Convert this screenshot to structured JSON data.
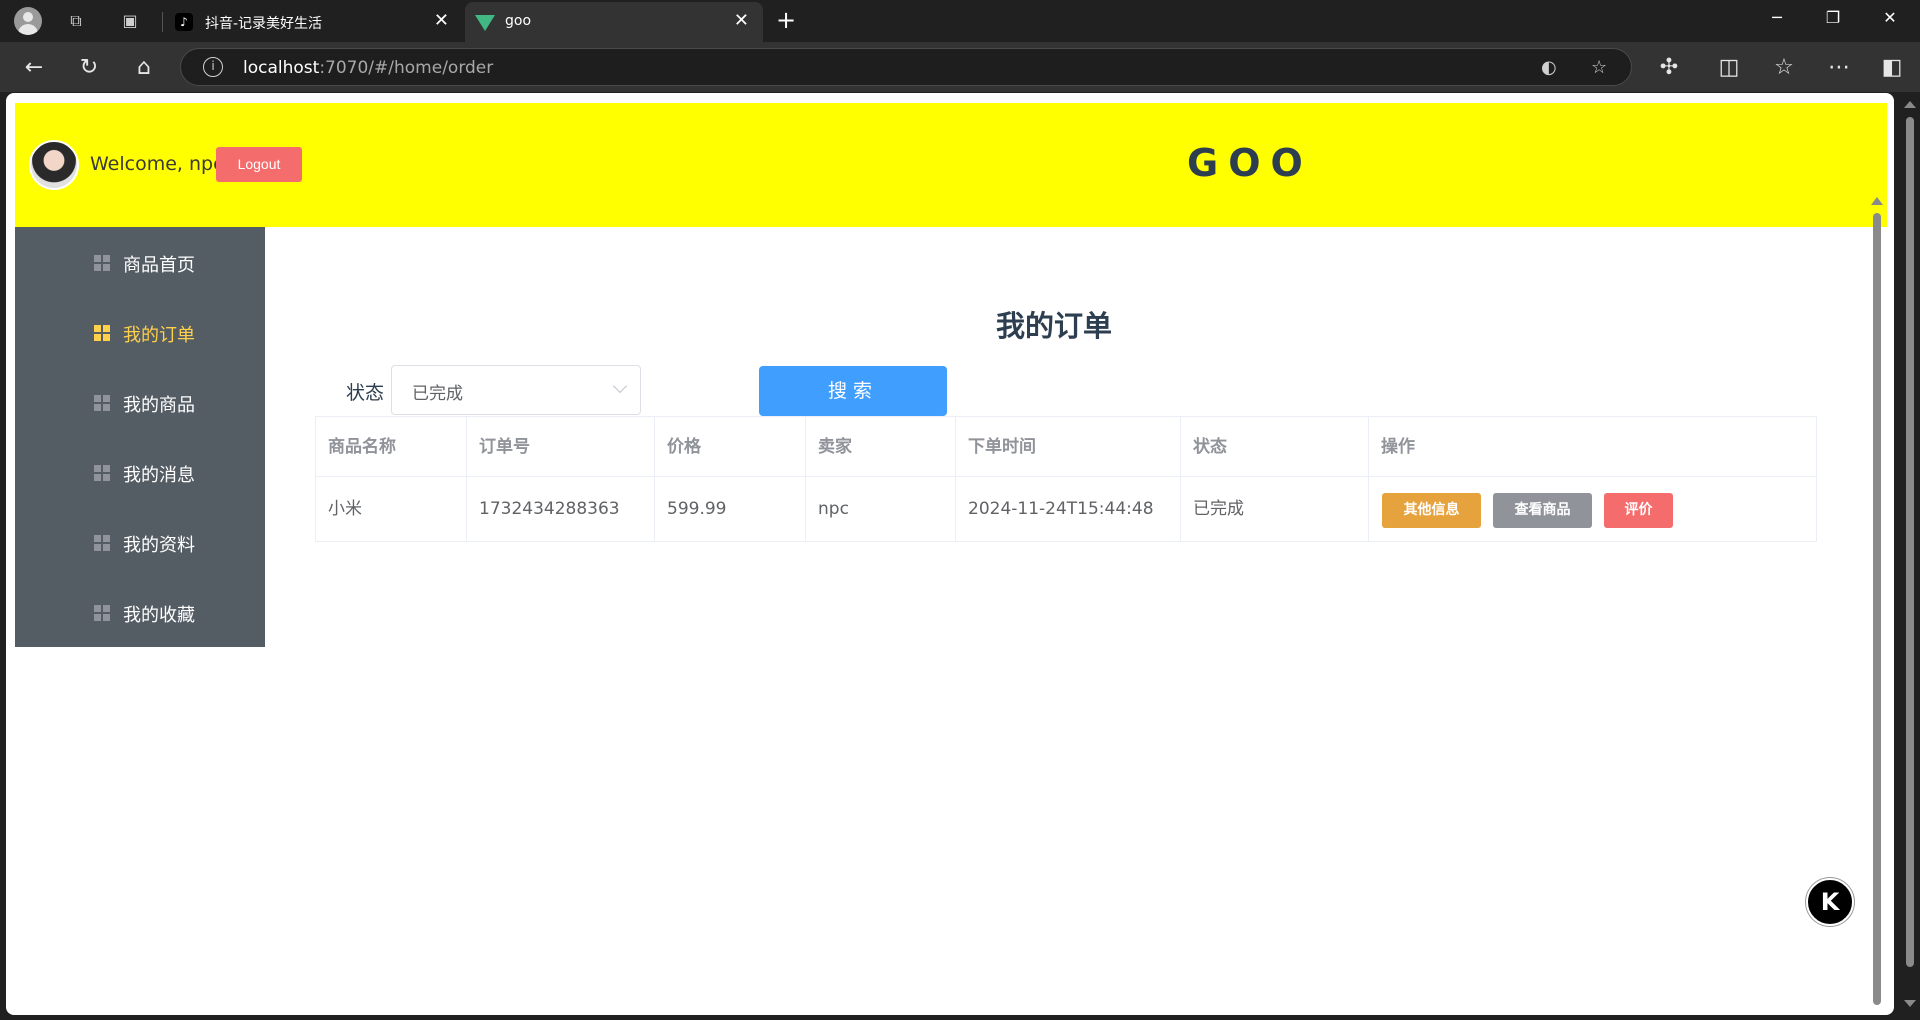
{
  "browser": {
    "tabs": [
      {
        "title": "抖音-记录美好生活",
        "favicon": "tiktok-icon",
        "active": false
      },
      {
        "title": "goo",
        "favicon": "vue-icon",
        "active": true
      }
    ],
    "url_host": "localhost",
    "url_path": ":7070/#/home/order"
  },
  "header": {
    "welcome": "Welcome, npc",
    "logout_label": "Logout",
    "brand": "GOO",
    "background": "#ffff00"
  },
  "sidebar": {
    "items": [
      {
        "label": "商品首页",
        "active": false
      },
      {
        "label": "我的订单",
        "active": true
      },
      {
        "label": "我的商品",
        "active": false
      },
      {
        "label": "我的消息",
        "active": false
      },
      {
        "label": "我的资料",
        "active": false
      },
      {
        "label": "我的收藏",
        "active": false
      }
    ],
    "active_color": "#ffd04b"
  },
  "main": {
    "title": "我的订单",
    "filter": {
      "status_label": "状态",
      "status_value": "已完成",
      "search_label": "搜索"
    },
    "table": {
      "columns": [
        "商品名称",
        "订单号",
        "价格",
        "卖家",
        "下单时间",
        "状态",
        "操作"
      ],
      "rows": [
        {
          "name": "小米",
          "order_no": "1732434288363",
          "price": "599.99",
          "seller": "npc",
          "time": "2024-11-24T15:44:48",
          "status": "已完成",
          "actions": [
            "其他信息",
            "查看商品",
            "评价"
          ]
        }
      ]
    }
  }
}
